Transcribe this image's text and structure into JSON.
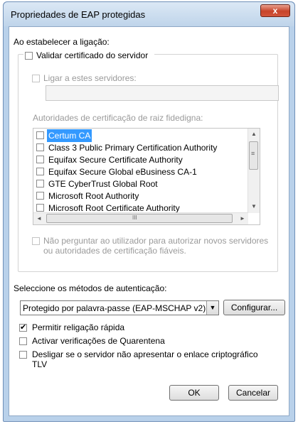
{
  "window": {
    "title": "Propriedades de EAP protegidas",
    "close_glyph": "x"
  },
  "connect_section": {
    "heading": "Ao estabelecer a ligação:",
    "validate_certificate": {
      "label": "Validar certificado do servidor",
      "checked": false
    },
    "connect_servers": {
      "label": "Ligar a estes servidores:",
      "checked": false,
      "value": ""
    },
    "root_ca_label": "Autoridades de certificação de raiz fidedigna:",
    "root_ca_list": [
      {
        "label": "Certum CA",
        "checked": false,
        "selected": true
      },
      {
        "label": "Class 3 Public Primary Certification Authority",
        "checked": false
      },
      {
        "label": "Equifax Secure Certificate Authority",
        "checked": false
      },
      {
        "label": "Equifax Secure Global eBusiness CA-1",
        "checked": false
      },
      {
        "label": "GTE CyberTrust Global Root",
        "checked": false
      },
      {
        "label": "Microsoft Root Authority",
        "checked": false
      },
      {
        "label": "Microsoft Root Certificate Authority",
        "checked": false
      }
    ],
    "dont_prompt": {
      "line1": "Não perguntar ao utilizador para autorizar novos servidores",
      "line2": "ou autoridades de certificação fiáveis.",
      "checked": false
    }
  },
  "auth_section": {
    "label": "Seleccione os métodos de autenticação:",
    "method_selected": "Protegido por palavra-passe (EAP-MSCHAP v2)",
    "configure_button": "Configurar..."
  },
  "options": {
    "fast_reconnect": {
      "label": "Permitir religação rápida",
      "checked": true
    },
    "quarantine": {
      "label": "Activar verificações de Quarentena",
      "checked": false
    },
    "disconnect": {
      "line1": "Desligar se o servidor não apresentar o enlace criptográfico",
      "line2": "TLV",
      "checked": false
    }
  },
  "buttons": {
    "ok": "OK",
    "cancel": "Cancelar"
  },
  "icons": {
    "scroll_up": "▲",
    "scroll_down": "▼",
    "scroll_left": "◄",
    "scroll_right": "►",
    "grip_v": "≡",
    "grip_h": "III",
    "dropdown": "▼",
    "check": "✔"
  }
}
